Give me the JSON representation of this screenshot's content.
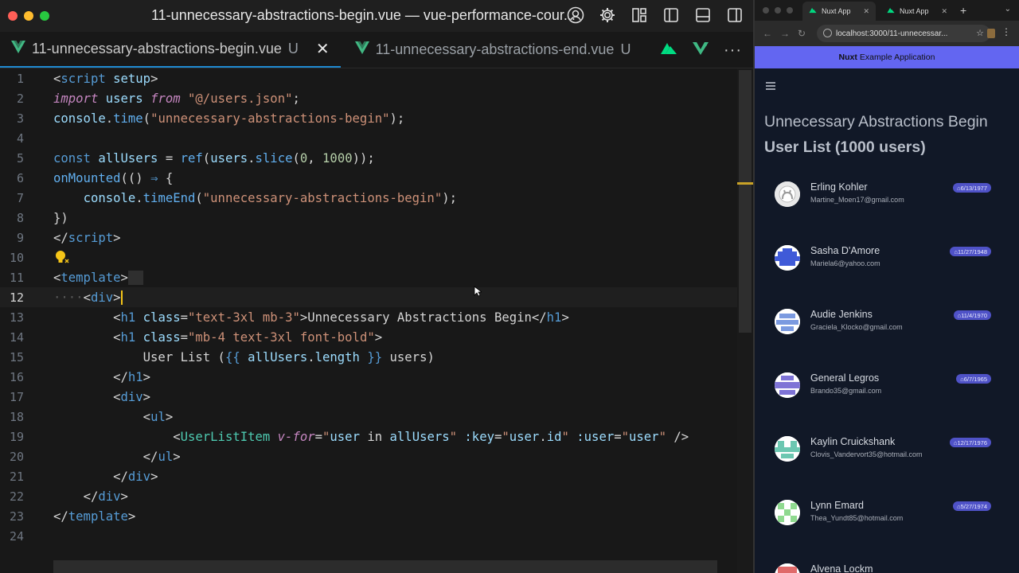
{
  "editor": {
    "window_title": "11-unnecessary-abstractions-begin.vue — vue-performance-cour...",
    "tabs": [
      {
        "label": "11-unnecessary-abstractions-begin.vue",
        "status": "U"
      },
      {
        "label": "11-unnecessary-abstractions-end.vue",
        "status": "U"
      }
    ],
    "current_line": "12",
    "line_numbers": [
      "1",
      "2",
      "3",
      "4",
      "5",
      "6",
      "7",
      "8",
      "9",
      "10",
      "11",
      "12",
      "13",
      "14",
      "15",
      "16",
      "17",
      "18",
      "19",
      "20",
      "21",
      "22",
      "23",
      "24"
    ]
  },
  "browser": {
    "tabs": [
      {
        "label": "Nuxt App"
      },
      {
        "label": "Nuxt App"
      }
    ],
    "url": "localhost:3000/11-unnecessar...",
    "banner": {
      "brand": "Nuxt",
      "text": "Example Application"
    },
    "page": {
      "title": "Unnecessary Abstractions Begin",
      "subtitle": "User List (1000 users)",
      "users": [
        {
          "name": "Erling Kohler",
          "email": "Martine_Moen17@gmail.com",
          "date": "6/13/1977",
          "avatar": "github"
        },
        {
          "name": "Sasha D'Amore",
          "email": "Mariela6@yahoo.com",
          "date": "11/27/1948",
          "avatar": "blue"
        },
        {
          "name": "Audie Jenkins",
          "email": "Graciela_Klocko@gmail.com",
          "date": "11/4/1970",
          "avatar": "lightblue"
        },
        {
          "name": "General Legros",
          "email": "Brando35@gmail.com",
          "date": "6/7/1965",
          "avatar": "purple"
        },
        {
          "name": "Kaylin Cruickshank",
          "email": "Clovis_Vandervort35@hotmail.com",
          "date": "12/17/1976",
          "avatar": "teal"
        },
        {
          "name": "Lynn Emard",
          "email": "Thea_Yundt85@hotmail.com",
          "date": "5/27/1974",
          "avatar": "green"
        },
        {
          "name": "Alvena Lockm",
          "email": "",
          "date": "",
          "avatar": "red"
        }
      ]
    }
  },
  "colors": {
    "accent": "#6366f1",
    "badge": "#4f52c7"
  }
}
